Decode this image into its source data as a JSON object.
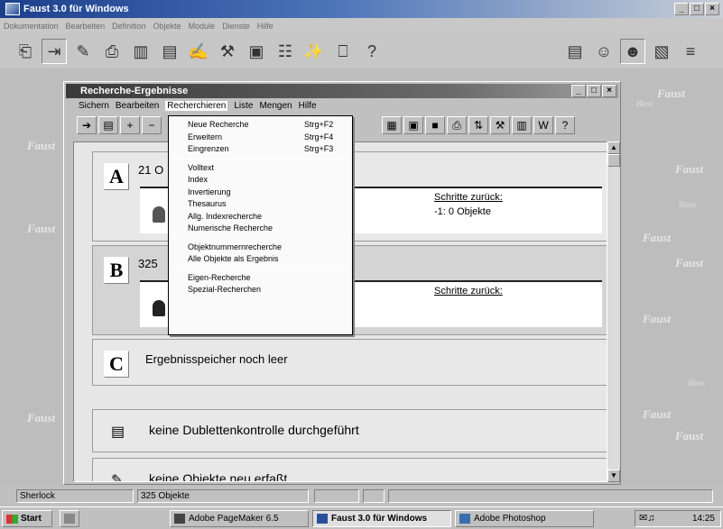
{
  "app": {
    "title": "Faust 3.0 für Windows",
    "menu": [
      "Dokumentation",
      "Bearbeiten",
      "Definition",
      "Objekte",
      "Module",
      "Dienste",
      "Hilfe"
    ],
    "toolbar_icons": [
      "exit-door-icon",
      "import-arrow-icon",
      "edit-pen-icon",
      "print-icon",
      "book-icon",
      "document-icon",
      "sign-icon",
      "tools-icon",
      "clipboard-icon",
      "tree-icon",
      "magic-icon",
      "printer-icon",
      "help-icon"
    ],
    "toolbar_right_icons": [
      "list-icon",
      "person-icon",
      "person-dark-icon",
      "notes-icon",
      "stack-icon"
    ],
    "watermark_text": "Faust",
    "watermark_small": "Bless"
  },
  "window_controls": {
    "minimize": "_",
    "maximize": "□",
    "close": "×"
  },
  "child": {
    "title": "Recherche-Ergebnisse",
    "menu": [
      "Sichern",
      "Bearbeiten",
      "Recherchieren",
      "Liste",
      "Mengen",
      "Hilfe"
    ]
  },
  "dropdown": {
    "groups": [
      [
        {
          "label": "Neue Recherche",
          "shortcut": "Strg+F2"
        },
        {
          "label": "Erweitern",
          "shortcut": "Strg+F4"
        },
        {
          "label": "Eingrenzen",
          "shortcut": "Strg+F3"
        }
      ],
      [
        {
          "label": "Volltext",
          "shortcut": ""
        },
        {
          "label": "Index",
          "shortcut": ""
        },
        {
          "label": "Invertierung",
          "shortcut": ""
        },
        {
          "label": "Thesaurus",
          "shortcut": ""
        },
        {
          "label": "Allg. Indexrecherche",
          "shortcut": ""
        },
        {
          "label": "Numerische Recherche",
          "shortcut": ""
        }
      ],
      [
        {
          "label": "Objektnummernrecherche",
          "shortcut": ""
        },
        {
          "label": "Alle Objekte als Ergebnis",
          "shortcut": ""
        }
      ],
      [
        {
          "label": "Eigen-Recherche",
          "shortcut": ""
        },
        {
          "label": "Spezial-Recherchen",
          "shortcut": ""
        }
      ]
    ]
  },
  "panels": {
    "a": {
      "letter": "A",
      "title": "21 O",
      "steps_label": "Schritte zurück:",
      "steps_value": "-1: 0 Objekte"
    },
    "b": {
      "letter": "B",
      "title": "325",
      "steps_label": "Schritte zurück:",
      "steps_value": ""
    },
    "c": {
      "letter": "C",
      "title": "Ergebnisspeicher noch leer"
    }
  },
  "rows": {
    "duplicates": "keine Dublettenkontrolle durchgeführt",
    "new_objects": "keine Objekte neu erfaßt"
  },
  "status": {
    "name": "Sherlock",
    "count": "325 Objekte"
  },
  "taskbar": {
    "start": "Start",
    "tasks": [
      "Adobe PageMaker 6.5",
      "Faust 3.0 für Windows",
      "Adobe Photoshop"
    ],
    "clock": "14:25"
  }
}
